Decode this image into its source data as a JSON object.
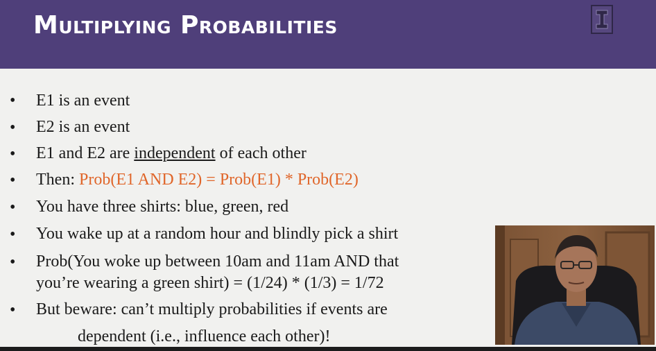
{
  "slide": {
    "title": "Multiplying Probabilities",
    "bullets": [
      {
        "text": "E1 is an event"
      },
      {
        "text": "E2 is an event"
      },
      {
        "pre": "E1 and E2 are ",
        "underlined": "independent",
        "post": " of each other"
      },
      {
        "pre": "Then: ",
        "formula": "Prob(E1 AND E2) = Prob(E1) * Prob(E2)"
      },
      {
        "text": "You have three shirts: blue, green, red"
      },
      {
        "text": "You wake up at a random hour and blindly pick a shirt"
      },
      {
        "line1": "Prob(You woke up between 10am and 11am AND that",
        "line2": "you’re wearing a green shirt) = (1/24) * (1/3) = 1/72"
      },
      {
        "line1": "But beware: can’t multiply probabilities if events are",
        "line2": "dependent (i.e., influence each other)!"
      }
    ],
    "bullet_glyph": "•"
  },
  "colors": {
    "header": "#4f3f7a",
    "formula": "#e0662a",
    "background": "#f1f1ef"
  },
  "icons": {
    "logo": "university-block-i-logo"
  }
}
